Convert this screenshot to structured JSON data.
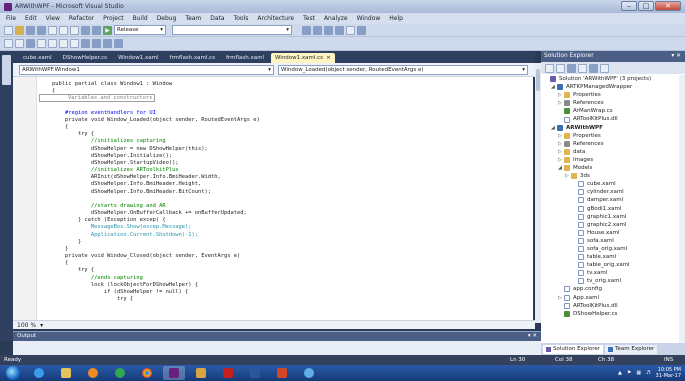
{
  "window": {
    "title": "ARWithWPF - Microsoft Visual Studio"
  },
  "menu": [
    "File",
    "Edit",
    "View",
    "Refactor",
    "Project",
    "Build",
    "Debug",
    "Team",
    "Data",
    "Tools",
    "Architecture",
    "Test",
    "Analyze",
    "Window",
    "Help"
  ],
  "toolbar": {
    "run_label": "▶",
    "config": "Release"
  },
  "tabs": [
    {
      "label": "cube.xaml",
      "active": false
    },
    {
      "label": "DShowHelper.cs",
      "active": false
    },
    {
      "label": "Window1.xaml",
      "active": false
    },
    {
      "label": "frmflash.xaml.cs",
      "active": false
    },
    {
      "label": "frmflash.xaml",
      "active": false
    },
    {
      "label": "Window1.xaml.cs",
      "active": true
    }
  ],
  "tab_close": "×",
  "nav": {
    "left": "ARWithWPF.Window1",
    "right": "Window_Loaded(object sender, RoutedEventArgs e)"
  },
  "code_lines": [
    "    public partial class Window1 : Window",
    "    {",
    "        Variables and constructors",
    "",
    "        #region eventhandlers for UI",
    "        private void Window_Loaded(object sender, RoutedEventArgs e)",
    "        {",
    "            try {",
    "                //initializes capturing",
    "                dShowHelper = new DShowHelper(this);",
    "                dShowHelper.Initialize();",
    "                dShowHelper.StartupVideo();",
    "                //initializes ARToolkitPlus",
    "                ARInit(dShowHelper.Info.BmiHeader.Width,",
    "                dShowHelper.Info.BmiHeader.Height,",
    "                dShowHelper.Info.BmiHeader.BitCount);",
    "",
    "                //starts drawing and AR",
    "                dShowHelper.OnBufferCallback += onBufferUpdated;",
    "            } catch (Exception excep) {",
    "                MessageBox.Show(excep.Message);",
    "                Application.Current.Shutdown(-1);",
    "            }",
    "        }",
    "        private void Window_Closed(object sender, EventArgs e)",
    "        {",
    "            try {",
    "                //ends capturing",
    "                lock (lockObjectForDShowHelper) {",
    "                    if (dShowHelper != null) {",
    "                        try {"
  ],
  "zoom": "100 %",
  "output": {
    "title": "Output",
    "pin": "▾ ✕"
  },
  "solution_explorer": {
    "title": "Solution Explorer",
    "pin": "▾ ✕",
    "items": [
      {
        "label": "Solution 'ARWithWPF' (3 projects)",
        "depth": 0,
        "icon": "sol",
        "twisty": ""
      },
      {
        "label": "ARTKPManagedWrapper",
        "depth": 1,
        "icon": "proj",
        "twisty": "◢"
      },
      {
        "label": "Properties",
        "depth": 2,
        "icon": "fold",
        "twisty": "▷"
      },
      {
        "label": "References",
        "depth": 2,
        "icon": "ref",
        "twisty": "▷"
      },
      {
        "label": "ArManWrap.cs",
        "depth": 2,
        "icon": "cs",
        "twisty": ""
      },
      {
        "label": "ARToolKitPlus.dll",
        "depth": 2,
        "icon": "file",
        "twisty": ""
      },
      {
        "label": "ARWithWPF",
        "depth": 1,
        "icon": "proj",
        "twisty": "◢",
        "bold": true
      },
      {
        "label": "Properties",
        "depth": 2,
        "icon": "fold",
        "twisty": "▷"
      },
      {
        "label": "References",
        "depth": 2,
        "icon": "ref",
        "twisty": "▷"
      },
      {
        "label": "data",
        "depth": 2,
        "icon": "fold",
        "twisty": "▷"
      },
      {
        "label": "Images",
        "depth": 2,
        "icon": "fold",
        "twisty": "▷"
      },
      {
        "label": "Models",
        "depth": 2,
        "icon": "fold",
        "twisty": "◢"
      },
      {
        "label": "3ds",
        "depth": 3,
        "icon": "fold",
        "twisty": "▷"
      },
      {
        "label": "cube.xaml",
        "depth": 4,
        "icon": "file",
        "twisty": ""
      },
      {
        "label": "cylinder.xaml",
        "depth": 4,
        "icon": "file",
        "twisty": ""
      },
      {
        "label": "damper.xaml",
        "depth": 4,
        "icon": "file",
        "twisty": ""
      },
      {
        "label": "gBodi1.xaml",
        "depth": 4,
        "icon": "file",
        "twisty": ""
      },
      {
        "label": "graphic1.xaml",
        "depth": 4,
        "icon": "file",
        "twisty": ""
      },
      {
        "label": "graphic2.xaml",
        "depth": 4,
        "icon": "file",
        "twisty": ""
      },
      {
        "label": "House.xaml",
        "depth": 4,
        "icon": "file",
        "twisty": ""
      },
      {
        "label": "sofa.xaml",
        "depth": 4,
        "icon": "file",
        "twisty": ""
      },
      {
        "label": "sofa_orig.xaml",
        "depth": 4,
        "icon": "file",
        "twisty": ""
      },
      {
        "label": "table.xaml",
        "depth": 4,
        "icon": "file",
        "twisty": ""
      },
      {
        "label": "table_orig.xaml",
        "depth": 4,
        "icon": "file",
        "twisty": ""
      },
      {
        "label": "tv.xaml",
        "depth": 4,
        "icon": "file",
        "twisty": ""
      },
      {
        "label": "tv_orig.xaml",
        "depth": 4,
        "icon": "file",
        "twisty": ""
      },
      {
        "label": "app.config",
        "depth": 2,
        "icon": "file",
        "twisty": ""
      },
      {
        "label": "App.xaml",
        "depth": 2,
        "icon": "file",
        "twisty": "▷"
      },
      {
        "label": "ARToolKitPlus.dll",
        "depth": 2,
        "icon": "file",
        "twisty": ""
      },
      {
        "label": "DShowHelper.cs",
        "depth": 2,
        "icon": "cs",
        "twisty": ""
      }
    ],
    "tabs": [
      "Solution Explorer",
      "Team Explorer"
    ]
  },
  "status": {
    "ready": "Ready",
    "ln": "Ln 30",
    "col": "Col 38",
    "ch": "Ch 38",
    "mode": "INS"
  },
  "taskbar": {
    "time": "10:05 PM",
    "date": "31-Mar-17"
  },
  "colors": {
    "keyword": "#0000ff",
    "type": "#2b91af",
    "comment": "#008000",
    "chrome": "#2e3f60"
  }
}
